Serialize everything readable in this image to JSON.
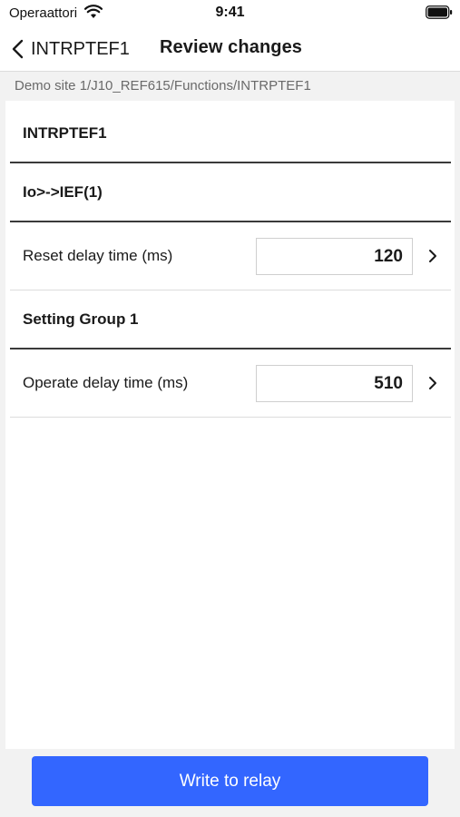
{
  "status_bar": {
    "carrier": "Operaattori",
    "time": "9:41",
    "wifi_icon": "wifi-icon",
    "battery_icon": "battery-icon"
  },
  "nav": {
    "back_label": "INTRPTEF1",
    "back_icon": "chevron-left-icon",
    "title": "Review changes"
  },
  "breadcrumb": "Demo site 1/J10_REF615/Functions/INTRPTEF1",
  "sections": [
    {
      "title": "INTRPTEF1"
    },
    {
      "title": "Io>->IEF(1)"
    },
    {
      "title": "Setting Group 1"
    }
  ],
  "parameters": [
    {
      "label": "Reset delay time (ms)",
      "value": "120",
      "icon": "chevron-right-icon"
    },
    {
      "label": "Operate delay time (ms)",
      "value": "510",
      "icon": "chevron-right-icon"
    }
  ],
  "actions": {
    "write_label": "Write to relay"
  },
  "colors": {
    "accent": "#3366ff",
    "background": "#f2f2f2",
    "panel": "#ffffff",
    "section_divider": "#3a3a3a",
    "row_divider": "#dcdcdc"
  }
}
